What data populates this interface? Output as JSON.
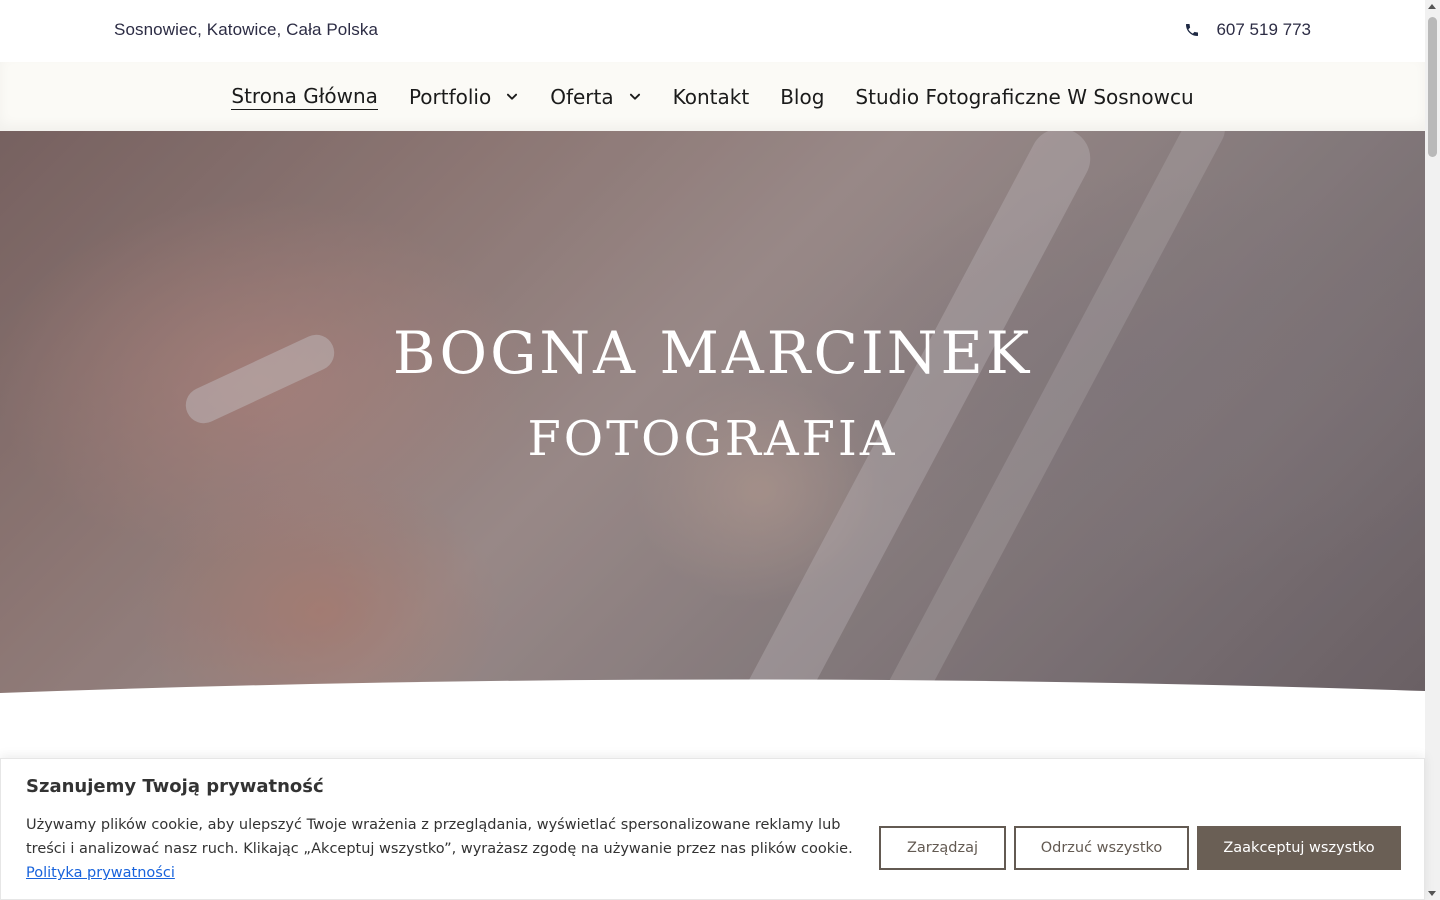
{
  "topbar": {
    "location": "Sosnowiec, Katowice, Cała Polska",
    "phone": "607 519 773",
    "phone_icon": "phone-icon"
  },
  "nav": {
    "items": [
      {
        "label": "Strona Główna",
        "active": true
      },
      {
        "label": "Portfolio",
        "dropdown": true
      },
      {
        "label": "Oferta",
        "dropdown": true
      },
      {
        "label": "Kontakt"
      },
      {
        "label": "Blog"
      },
      {
        "label": "Studio Fotograficzne W Sosnowcu"
      }
    ]
  },
  "hero": {
    "title": "BOGNA MARCINEK",
    "subtitle": "FOTOGRAFIA"
  },
  "cookie": {
    "title": "Szanujemy Twoją prywatność",
    "text": "Używamy plików cookie, aby ulepszyć Twoje wrażenia z przeglądania, wyświetlać spersonalizowane reklamy lub treści i analizować nasz ruch. Klikając „Akceptuj wszystko”, wyrażasz zgodę na używanie przez nas plików cookie.",
    "policy_link": "Polityka prywatności",
    "buttons": {
      "manage": "Zarządzaj",
      "reject": "Odrzuć wszystko",
      "accept": "Zaakceptuj wszystko"
    }
  },
  "colors": {
    "nav_bg": "#fbfaf6",
    "accent": "#6a5f55",
    "link": "#1863dc"
  }
}
